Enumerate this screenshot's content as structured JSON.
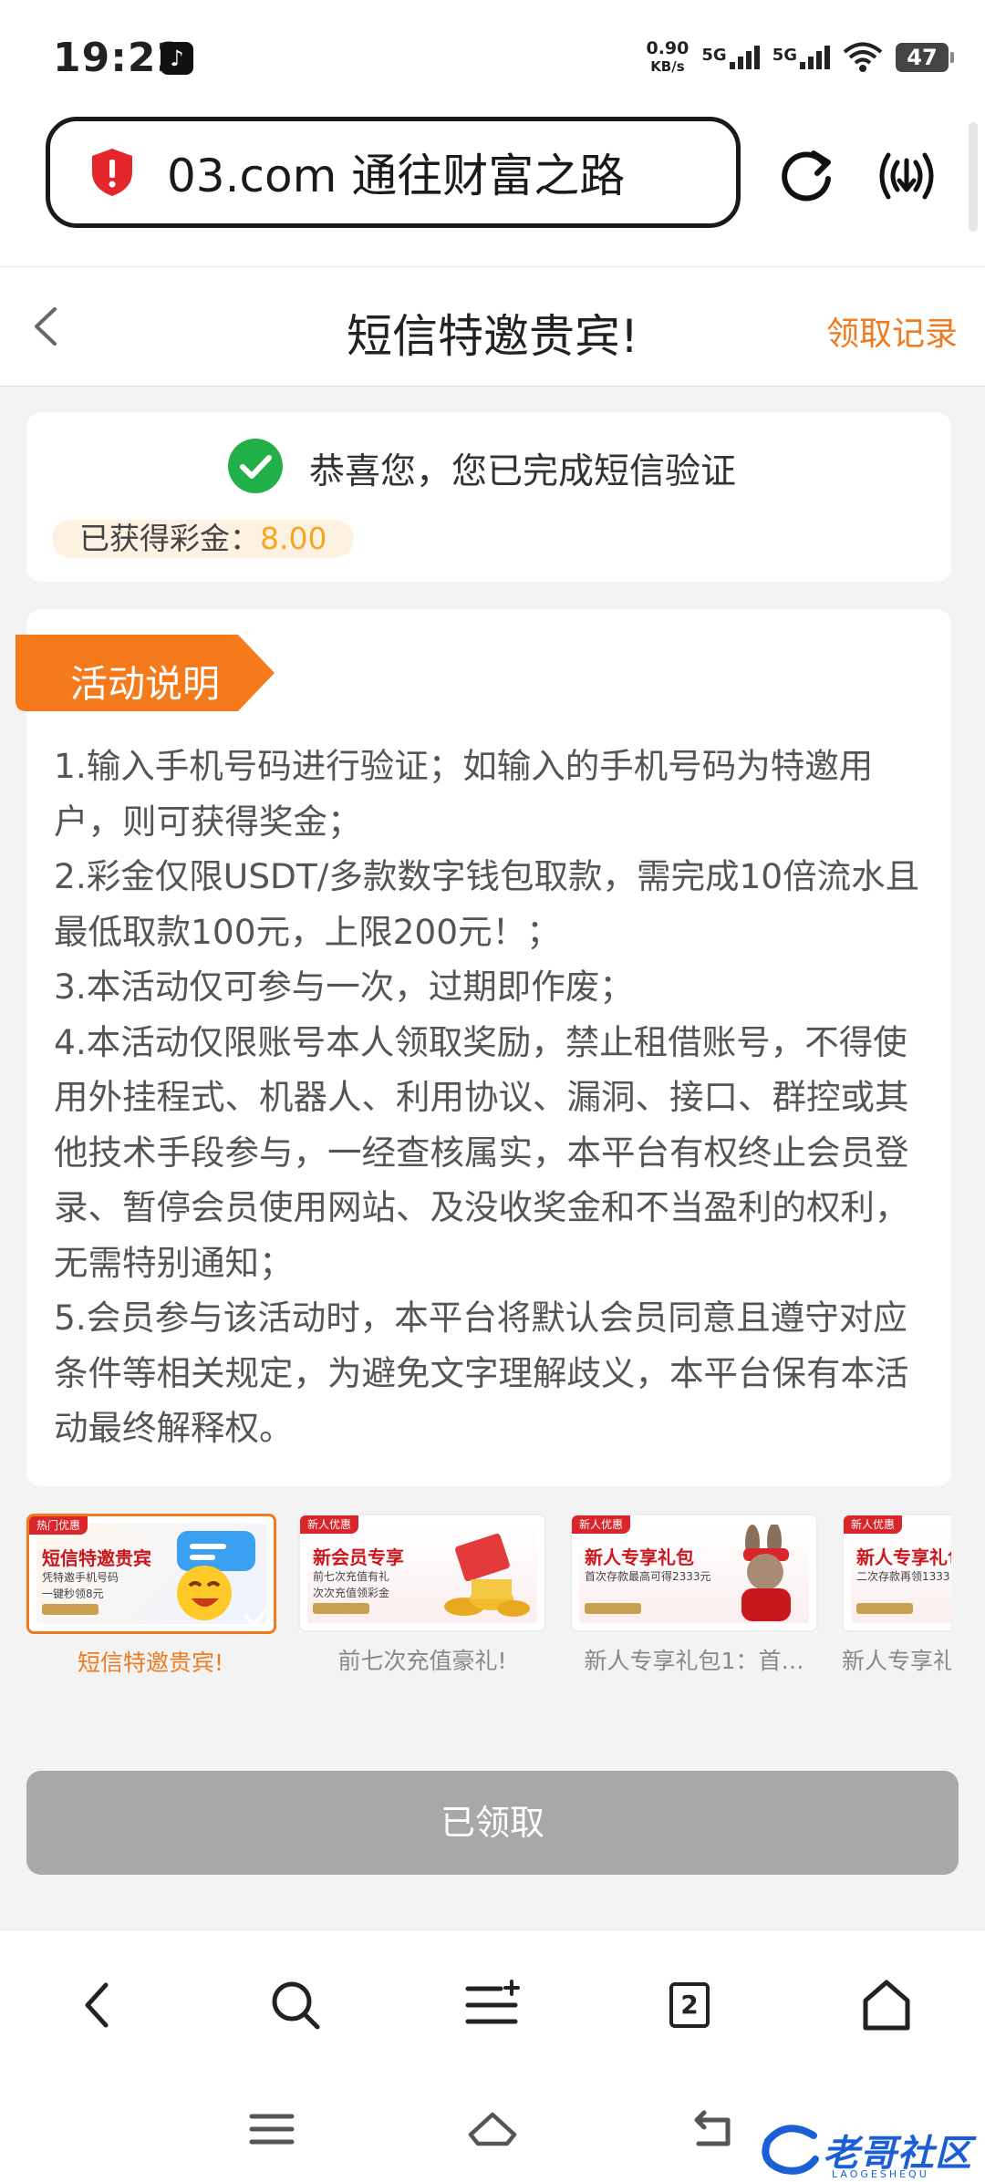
{
  "status_bar": {
    "time": "19:22",
    "net_speed_value": "0.90",
    "net_speed_unit": "KB/s",
    "sim1_type": "5G",
    "sim2_type": "5G",
    "battery": "47"
  },
  "browser": {
    "url_text": "03.com 通往财富之路",
    "tab_count": "2"
  },
  "header": {
    "title": "短信特邀贵宾!",
    "records_link": "领取记录"
  },
  "verify": {
    "message": "恭喜您，您已完成短信验证",
    "bonus_label": "已获得彩金：",
    "bonus_value": "8.00"
  },
  "activity": {
    "tag_label": "活动说明",
    "rules": [
      "1.输入手机号码进行验证；如输入的手机号码为特邀用户，则可获得奖金；",
      "2.彩金仅限USDT/多款数字钱包取款，需完成10倍流水且最低取款100元，上限200元！；",
      "3.本活动仅可参与一次，过期即作废；",
      "4.本活动仅限账号本人领取奖励，禁止租借账号，不得使用外挂程式、机器人、利用协议、漏洞、接口、群控或其他技术手段参与，一经查核属实，本平台有权终止会员登录、暂停会员使用网站、及没收奖金和不当盈利的权利，无需特别通知；",
      "5.会员参与该活动时，本平台将默认会员同意且遵守对应条件等相关规定，为避免文字理解歧义，本平台保有本活动最终解释权。"
    ]
  },
  "promos": [
    {
      "badge": "热门优惠",
      "title": "短信特邀贵宾",
      "line1": "凭特邀手机号码",
      "line2": "一键秒领8元",
      "caption": "短信特邀贵宾!",
      "active": true
    },
    {
      "badge": "新人优惠",
      "title": "新会员专享",
      "line1": "前七次充值有礼",
      "line2": "次次充值领彩金",
      "caption": "前七次充值豪礼!",
      "active": false
    },
    {
      "badge": "新人优惠",
      "title": "新人专享礼包",
      "line1": "首次存款最高可得2333元",
      "line2": "",
      "caption": "新人专享礼包1：首…",
      "active": false
    },
    {
      "badge": "新人优惠",
      "title": "新人专享礼包",
      "line1": "二次存款再领1333",
      "line2": "",
      "caption": "新人专享礼",
      "active": false
    }
  ],
  "claim_button": "已领取",
  "watermark": {
    "main": "老哥社区",
    "sub": "LAOGESHEQU"
  },
  "colors": {
    "accent": "#f07a1e",
    "success": "#22b04b",
    "bonus": "#f5a623",
    "disabled": "#a8a8a8"
  },
  "icons": {
    "url_badge": "red-shield-icon",
    "reload": "reload-icon",
    "broadcast": "broadcast-icon",
    "verify": "green-check-icon"
  }
}
